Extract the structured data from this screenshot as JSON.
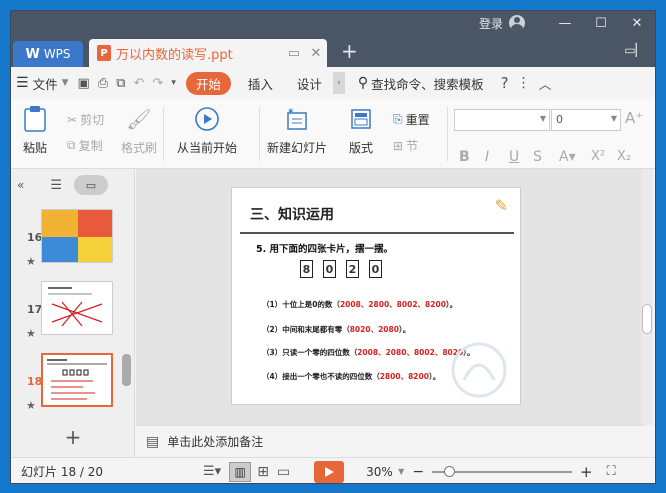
{
  "titlebar": {
    "login_label": "登录",
    "tabs": [
      {
        "label": "WPS",
        "logo": "W"
      },
      {
        "label": "万以内数的读写.ppt",
        "badge": "P"
      }
    ]
  },
  "menu": {
    "file_label": "文件",
    "tabs": [
      "开始",
      "插入",
      "设计"
    ],
    "search_label": "查找命令、搜索模板"
  },
  "ribbon": {
    "paste": "粘贴",
    "cut": "剪切",
    "copy": "复制",
    "format_painter": "格式刷",
    "play_from_current": "从当前开始",
    "new_slide": "新建幻灯片",
    "layout": "版式",
    "reset": "重置",
    "section": "节",
    "font_size_value": "0"
  },
  "slides_panel": {
    "thumbs": [
      {
        "num": "16"
      },
      {
        "num": "17"
      },
      {
        "num": "18",
        "active": true
      }
    ]
  },
  "slide": {
    "title": "三、知识运用",
    "question": "5. 用下面的四张卡片，摆一摆。",
    "cards": [
      "8",
      "0",
      "2",
      "0"
    ],
    "answers": [
      {
        "prefix": "（1）十位上是0的数（",
        "values": "2008、2800、8002、8200",
        "suffix": "）。"
      },
      {
        "prefix": "（2）中间和末尾都有零（",
        "values": "8020、2080",
        "suffix": "）。"
      },
      {
        "prefix": "（3）只读一个零的四位数（",
        "values": "2008、2080、8002、8020",
        "suffix": "）。"
      },
      {
        "prefix": "（4）接出一个零也不读的四位数（",
        "values": "2800、8200",
        "suffix": "）。"
      }
    ]
  },
  "notes": {
    "placeholder": "单击此处添加备注"
  },
  "status": {
    "slide_counter": "幻灯片 18 / 20",
    "zoom": "30%",
    "zoom_fraction": 0.3
  },
  "colors": {
    "accent": "#e8673a",
    "answer_red": "#d42020",
    "titlebar": "#4a5566",
    "wps_tab": "#3b78c9"
  }
}
